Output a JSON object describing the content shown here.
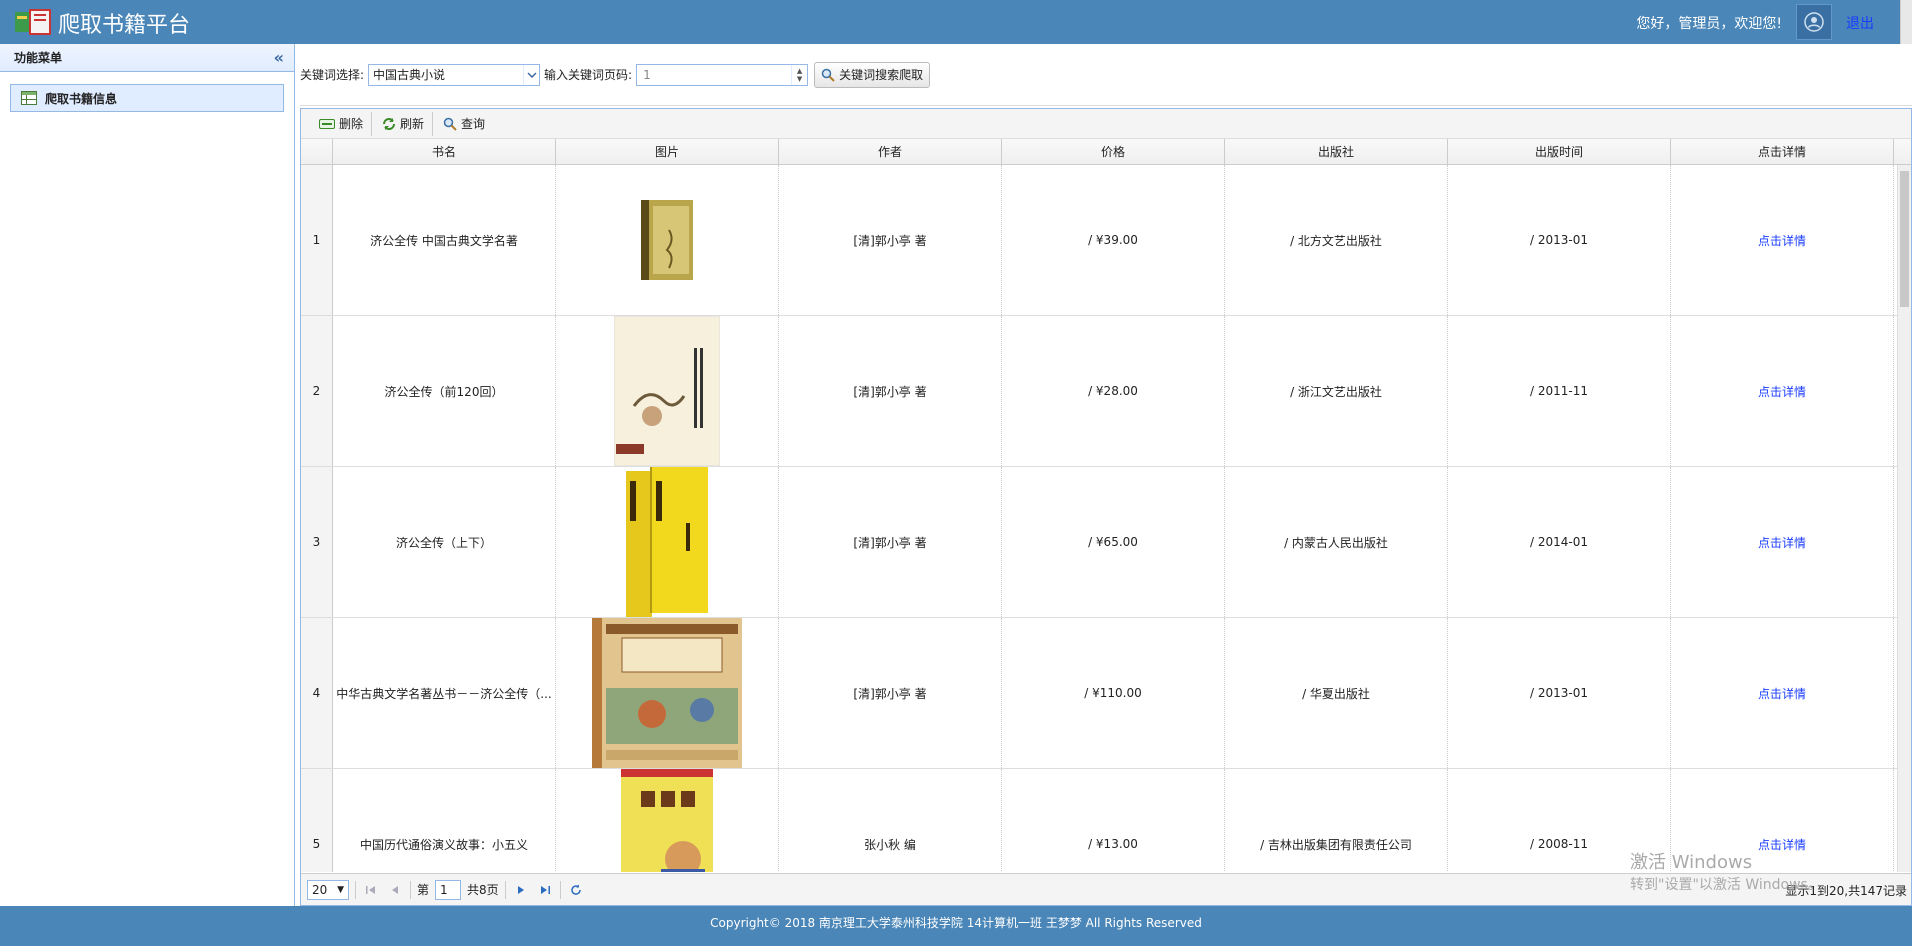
{
  "header": {
    "title": "爬取书籍平台",
    "welcome": "您好，管理员，欢迎您!",
    "logout": "退出"
  },
  "sidebar": {
    "title": "功能菜单",
    "items": [
      {
        "label": "爬取书籍信息"
      }
    ]
  },
  "search": {
    "keyword_label": "关键词选择:",
    "keyword_value": "中国古典小说",
    "page_label": "输入关键词页码:",
    "page_value": "1",
    "button": "关键词搜索爬取"
  },
  "toolbar": {
    "delete": "删除",
    "refresh": "刷新",
    "query": "查询"
  },
  "columns": [
    "书名",
    "图片",
    "作者",
    "价格",
    "出版社",
    "出版时间",
    "点击详情"
  ],
  "rows": [
    {
      "n": "1",
      "title": "济公全传 中国古典文学名著",
      "author": "[清]郭小亭 著",
      "price": "/ ¥39.00",
      "publisher": "/ 北方文艺出版社",
      "date": "/ 2013-01",
      "detail": "点击详情"
    },
    {
      "n": "2",
      "title": "济公全传（前120回）",
      "author": "[清]郭小亭 著",
      "price": "/ ¥28.00",
      "publisher": "/ 浙江文艺出版社",
      "date": "/ 2011-11",
      "detail": "点击详情"
    },
    {
      "n": "3",
      "title": "济公全传（上下）",
      "author": "[清]郭小亭 著",
      "price": "/ ¥65.00",
      "publisher": "/ 内蒙古人民出版社",
      "date": "/ 2014-01",
      "detail": "点击详情"
    },
    {
      "n": "4",
      "title": "中华古典文学名著丛书－－济公全传（...",
      "author": "[清]郭小亭 著",
      "price": "/ ¥110.00",
      "publisher": "/ 华夏出版社",
      "date": "/ 2013-01",
      "detail": "点击详情"
    },
    {
      "n": "5",
      "title": "中国历代通俗演义故事：小五义",
      "author": "张小秋 编",
      "price": "/ ¥13.00",
      "publisher": "/ 吉林出版集团有限责任公司",
      "date": "/ 2008-11",
      "detail": "点击详情"
    }
  ],
  "pager": {
    "page_size": "20",
    "page_prefix": "第",
    "page": "1",
    "page_suffix": "共8页",
    "info": "显示1到20,共147记录"
  },
  "watermark": {
    "line1": "激活 Windows",
    "line2": "转到\"设置\"以激活 Windows。"
  },
  "footer": "Copyright© 2018    南京理工大学泰州科技学院    14计算机一班 王梦梦   All Rights Reserved"
}
